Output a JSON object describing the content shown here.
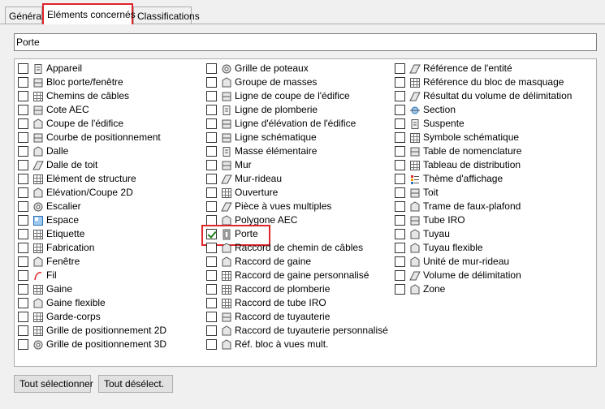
{
  "tabs": [
    "Général",
    "Eléments concernés",
    "Classifications"
  ],
  "selected_text": "Porte",
  "columns": [
    [
      {
        "label": "Appareil",
        "icon": "appliance-icon",
        "checked": false
      },
      {
        "label": "Bloc porte/fenêtre",
        "icon": "door-window-assembly-icon",
        "checked": false
      },
      {
        "label": "Chemins de câbles",
        "icon": "cable-tray-icon",
        "checked": false
      },
      {
        "label": "Cote AEC",
        "icon": "aec-dimension-icon",
        "checked": false
      },
      {
        "label": "Coupe de l'édifice",
        "icon": "building-section-icon",
        "checked": false
      },
      {
        "label": "Courbe de positionnement",
        "icon": "layout-curve-icon",
        "checked": false
      },
      {
        "label": "Dalle",
        "icon": "slab-icon",
        "checked": false
      },
      {
        "label": "Dalle de toit",
        "icon": "roof-slab-icon",
        "checked": false
      },
      {
        "label": "Elément de structure",
        "icon": "structural-member-icon",
        "checked": false
      },
      {
        "label": "Elévation/Coupe 2D",
        "icon": "elevation-2d-icon",
        "checked": false
      },
      {
        "label": "Escalier",
        "icon": "stair-icon",
        "checked": false
      },
      {
        "label": "Espace",
        "icon": "space-icon",
        "checked": false
      },
      {
        "label": "Etiquette",
        "icon": "tag-icon",
        "checked": false
      },
      {
        "label": "Fabrication",
        "icon": "fabrication-icon",
        "checked": false
      },
      {
        "label": "Fenêtre",
        "icon": "window-icon",
        "checked": false
      },
      {
        "label": "Fil",
        "icon": "wire-icon",
        "checked": false
      },
      {
        "label": "Gaine",
        "icon": "duct-icon",
        "checked": false
      },
      {
        "label": "Gaine flexible",
        "icon": "flex-duct-icon",
        "checked": false
      },
      {
        "label": "Garde-corps",
        "icon": "railing-icon",
        "checked": false
      },
      {
        "label": "Grille de positionnement 2D",
        "icon": "layout-grid-2d-icon",
        "checked": false
      },
      {
        "label": "Grille de positionnement 3D",
        "icon": "layout-grid-3d-icon",
        "checked": false
      }
    ],
    [
      {
        "label": "Grille de poteaux",
        "icon": "column-grid-icon",
        "checked": false
      },
      {
        "label": "Groupe de masses",
        "icon": "mass-group-icon",
        "checked": false
      },
      {
        "label": "Ligne de coupe de l'édifice",
        "icon": "section-line-icon",
        "checked": false
      },
      {
        "label": "Ligne de plomberie",
        "icon": "plumbing-line-icon",
        "checked": false
      },
      {
        "label": "Ligne d'élévation de l'édifice",
        "icon": "elevation-line-icon",
        "checked": false
      },
      {
        "label": "Ligne schématique",
        "icon": "schematic-line-icon",
        "checked": false
      },
      {
        "label": "Masse élémentaire",
        "icon": "mass-element-icon",
        "checked": false
      },
      {
        "label": "Mur",
        "icon": "wall-icon",
        "checked": false
      },
      {
        "label": "Mur-rideau",
        "icon": "curtain-wall-icon",
        "checked": false
      },
      {
        "label": "Ouverture",
        "icon": "opening-icon",
        "checked": false
      },
      {
        "label": "Pièce à vues multiples",
        "icon": "multi-view-part-icon",
        "checked": false
      },
      {
        "label": "Polygone AEC",
        "icon": "aec-polygon-icon",
        "checked": false
      },
      {
        "label": "Porte",
        "icon": "door-icon",
        "checked": true
      },
      {
        "label": "Raccord de chemin de câbles",
        "icon": "cable-tray-fitting-icon",
        "checked": false
      },
      {
        "label": "Raccord de gaine",
        "icon": "duct-fitting-icon",
        "checked": false
      },
      {
        "label": "Raccord de gaine personnalisé",
        "icon": "custom-duct-fitting-icon",
        "checked": false
      },
      {
        "label": "Raccord de plomberie",
        "icon": "plumbing-fitting-icon",
        "checked": false
      },
      {
        "label": "Raccord de tube IRO",
        "icon": "conduit-fitting-icon",
        "checked": false
      },
      {
        "label": "Raccord de tuyauterie",
        "icon": "pipe-fitting-icon",
        "checked": false
      },
      {
        "label": "Raccord de tuyauterie personnalisé",
        "icon": "custom-pipe-fitting-icon",
        "checked": false
      },
      {
        "label": "Réf. bloc à vues mult.",
        "icon": "mvblock-ref-icon",
        "checked": false
      }
    ],
    [
      {
        "label": "Référence de l'entité",
        "icon": "entity-ref-icon",
        "checked": false
      },
      {
        "label": "Référence du bloc de masquage",
        "icon": "masking-block-ref-icon",
        "checked": false
      },
      {
        "label": "Résultat du volume de délimitation",
        "icon": "space-boundary-result-icon",
        "checked": false
      },
      {
        "label": "Section",
        "icon": "section-icon",
        "checked": false
      },
      {
        "label": "Suspente",
        "icon": "hanger-icon",
        "checked": false
      },
      {
        "label": "Symbole schématique",
        "icon": "schematic-symbol-icon",
        "checked": false
      },
      {
        "label": "Table de nomenclature",
        "icon": "schedule-table-icon",
        "checked": false
      },
      {
        "label": "Tableau de distribution",
        "icon": "panel-icon",
        "checked": false
      },
      {
        "label": "Thème d'affichage",
        "icon": "display-theme-icon",
        "checked": false
      },
      {
        "label": "Toit",
        "icon": "roof-icon",
        "checked": false
      },
      {
        "label": "Trame de faux-plafond",
        "icon": "ceiling-grid-icon",
        "checked": false
      },
      {
        "label": "Tube IRO",
        "icon": "conduit-icon",
        "checked": false
      },
      {
        "label": "Tuyau",
        "icon": "pipe-icon",
        "checked": false
      },
      {
        "label": "Tuyau flexible",
        "icon": "flex-pipe-icon",
        "checked": false
      },
      {
        "label": "Unité de mur-rideau",
        "icon": "curtain-wall-unit-icon",
        "checked": false
      },
      {
        "label": "Volume de délimitation",
        "icon": "boundary-volume-icon",
        "checked": false
      },
      {
        "label": "Zone",
        "icon": "zone-icon",
        "checked": false
      }
    ]
  ],
  "buttons": {
    "select_all": "Tout sélectionner",
    "deselect_all": "Tout désélect."
  },
  "colors": {
    "highlight": "#e0242a",
    "check": "#1e7e1e"
  }
}
